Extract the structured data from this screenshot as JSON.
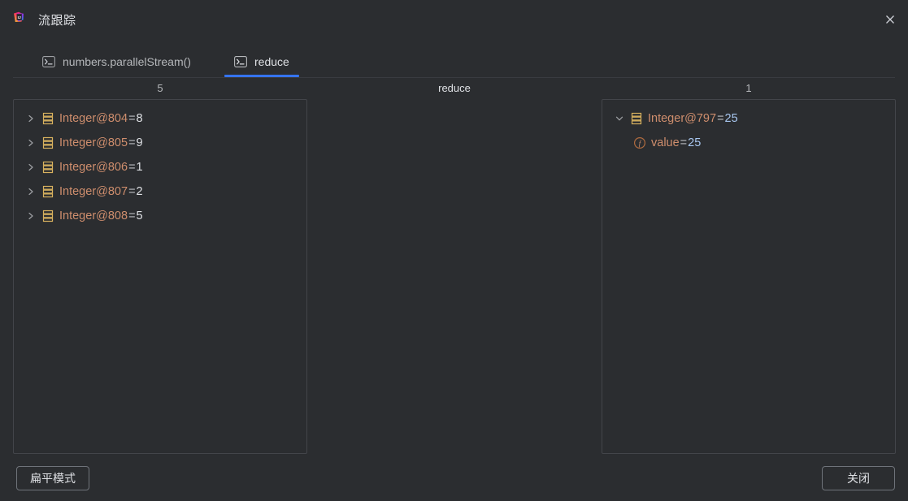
{
  "window": {
    "title": "流跟踪",
    "logo_icon": "intellij-idea-logo",
    "close_icon": "close-icon"
  },
  "tabs": [
    {
      "label": "numbers.parallelStream()",
      "icon": "console-icon",
      "active": false
    },
    {
      "label": "reduce",
      "icon": "console-icon",
      "active": true
    }
  ],
  "columns": {
    "left_header": "5",
    "middle_header": "reduce",
    "right_header": "1"
  },
  "left_panel": {
    "rows": [
      {
        "toggle": "chevron-right-icon",
        "icon": "object-instance-icon",
        "name": "Integer@804",
        "eq": "=",
        "value": "8"
      },
      {
        "toggle": "chevron-right-icon",
        "icon": "object-instance-icon",
        "name": "Integer@805",
        "eq": "=",
        "value": "9"
      },
      {
        "toggle": "chevron-right-icon",
        "icon": "object-instance-icon",
        "name": "Integer@806",
        "eq": "=",
        "value": "1"
      },
      {
        "toggle": "chevron-right-icon",
        "icon": "object-instance-icon",
        "name": "Integer@807",
        "eq": "=",
        "value": "2"
      },
      {
        "toggle": "chevron-right-icon",
        "icon": "object-instance-icon",
        "name": "Integer@808",
        "eq": "=",
        "value": "5"
      }
    ]
  },
  "right_panel": {
    "root": {
      "toggle": "chevron-down-icon",
      "icon": "object-instance-icon",
      "name": "Integer@797",
      "eq": "=",
      "value": "25"
    },
    "child": {
      "icon": "field-icon",
      "name": "value",
      "eq": "=",
      "value": "25"
    }
  },
  "buttons": {
    "flat_mode": "扁平模式",
    "close": "关闭"
  },
  "colors": {
    "background": "#2b2d30",
    "panel_border": "#43454a",
    "accent_blue": "#3574f0",
    "object_orange": "#cf8e6d",
    "number_blue": "#a8c7f0",
    "icon_gold": "#d9b25f",
    "text": "#dfe1e5",
    "text_dim": "#b6b8bb"
  }
}
